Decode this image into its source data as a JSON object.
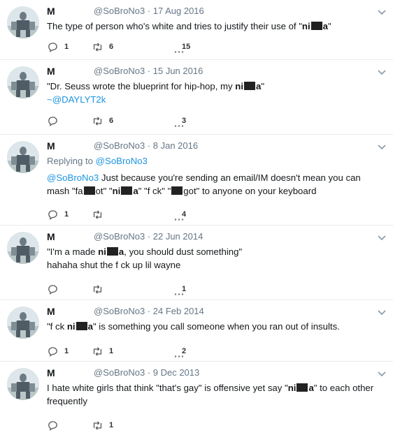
{
  "account": {
    "name": "M",
    "handle": "@SoBroNo3"
  },
  "tweets": [
    {
      "date": "17 Aug 2016",
      "replies": "1",
      "retweets": "6",
      "likes": "15"
    },
    {
      "date": "15 Jun 2016",
      "mention": "~@DAYLYT2k",
      "replies": "",
      "retweets": "6",
      "likes": "3"
    },
    {
      "date": "8 Jan 2016",
      "replying_label": "Replying to",
      "replying_handle": "@SoBroNo3",
      "lead_mention": "@SoBroNo3",
      "replies": "1",
      "retweets": "",
      "likes": "4"
    },
    {
      "date": "22 Jun 2014",
      "replies": "",
      "retweets": "",
      "likes": "1"
    },
    {
      "date": "24 Feb 2014",
      "replies": "1",
      "retweets": "1",
      "likes": "2"
    },
    {
      "date": "9 Dec 2013",
      "replies": "",
      "retweets": "1",
      "likes": ""
    }
  ],
  "text": {
    "t1": [
      "The type of person who's white and tries to justify their use of \"",
      "ni",
      "a",
      "\""
    ],
    "t2": [
      "\"Dr. Seuss wrote the blueprint for hip-hop, my ",
      "ni",
      "a",
      "\""
    ],
    "t3": [
      " Just because you're sending an email/IM doesn't mean you can mash \"fa",
      "ot\" \"",
      "ni",
      "a",
      "\" \"f ck\" \"",
      "got\" to anyone on your keyboard"
    ],
    "t4a": [
      "\"I'm a made ",
      "ni",
      "a",
      ", you should dust something\""
    ],
    "t4b": "hahaha shut the f ck up lil wayne",
    "t5": [
      "\"f ck ",
      "ni",
      "a",
      "\" is something you call someone when you ran out of insults."
    ],
    "t6": [
      "I hate white girls that think \"that's gay\" is offensive yet say \"",
      "ni",
      "a",
      "\" to each other frequently"
    ]
  },
  "icons": {
    "reply": "reply-icon",
    "retweet": "retweet-icon",
    "like": "like-icon",
    "menu": "chevron-down-icon",
    "avatar": "avatar-image"
  },
  "colors": {
    "link": "#1b95e0",
    "muted": "#657786",
    "censor": "#222222"
  }
}
